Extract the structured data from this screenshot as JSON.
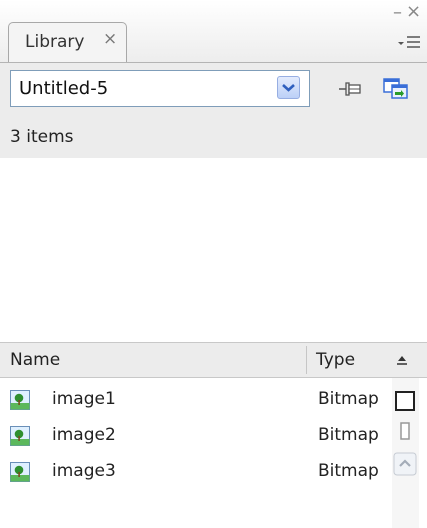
{
  "panel": {
    "tab_label": "Library",
    "tab_close_icon": "close-icon",
    "window_controls": [
      "minimize-icon",
      "close-icon",
      "panel-menu-icon"
    ]
  },
  "library_select": {
    "value": "Untitled-5",
    "arrow_icon": "chevron-down-icon"
  },
  "toolbar": {
    "pin_icon": "pin-icon",
    "new_library_icon": "new-library-panel-icon"
  },
  "item_count": "3 items",
  "columns": {
    "name": "Name",
    "type": "Type"
  },
  "items": [
    {
      "name": "image1",
      "type": "Bitmap",
      "icon": "bitmap-icon"
    },
    {
      "name": "image2",
      "type": "Bitmap",
      "icon": "bitmap-icon"
    },
    {
      "name": "image3",
      "type": "Bitmap",
      "icon": "bitmap-icon"
    }
  ],
  "colors": {
    "panel_bg": "#ececec",
    "dropdown_border": "#7f9db9",
    "dropdown_arrow": "#2f5fbf"
  }
}
